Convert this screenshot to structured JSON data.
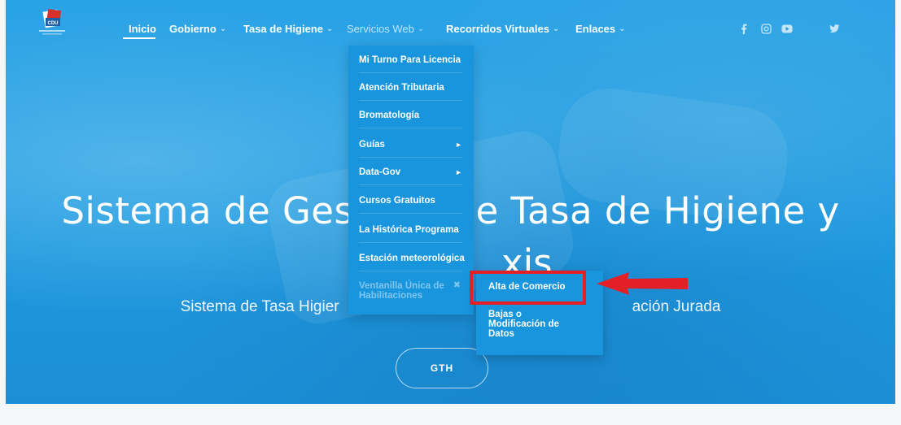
{
  "nav": {
    "items": [
      {
        "label": "Inicio",
        "chevron": ""
      },
      {
        "label": "Gobierno",
        "chevron": "⌄"
      },
      {
        "label": "Tasa de Higiene",
        "chevron": "⌄"
      },
      {
        "label": "Servicios Web",
        "chevron": "⌄"
      },
      {
        "label": "Recorridos Virtuales",
        "chevron": "⌄"
      },
      {
        "label": "Enlaces",
        "chevron": "⌄"
      }
    ],
    "social": [
      "facebook-icon",
      "instagram-icon",
      "youtube-icon",
      "twitter-icon"
    ]
  },
  "dropdown": {
    "items": [
      {
        "label": "Mi Turno Para Licencia"
      },
      {
        "label": "Atención Tributaria"
      },
      {
        "label": "Bromatología"
      },
      {
        "label": "Guías",
        "arrow": "►"
      },
      {
        "label": "Data-Gov",
        "arrow": "►"
      },
      {
        "label": "Cursos Gratuitos"
      },
      {
        "label": "La Histórica Programa"
      },
      {
        "label": "Estación meteorológica"
      }
    ],
    "disabled_item": {
      "label": "Ventanilla Única de Habilitaciones",
      "icon": "✖"
    }
  },
  "submenu": {
    "items": [
      {
        "label": "Alta de Comercio"
      },
      {
        "label": "Bajas o Modificación de Datos"
      }
    ]
  },
  "hero": {
    "title_left": "Sistema de Ges",
    "title_right": "e Tasa de Higiene y",
    "title_line2": "xis",
    "subtitle_left": "Sistema de Tasa Higier",
    "subtitle_right": "ación Jurada",
    "cta": "GTH"
  },
  "colors": {
    "accent": "#1895dd",
    "annotation": "#e32026"
  }
}
